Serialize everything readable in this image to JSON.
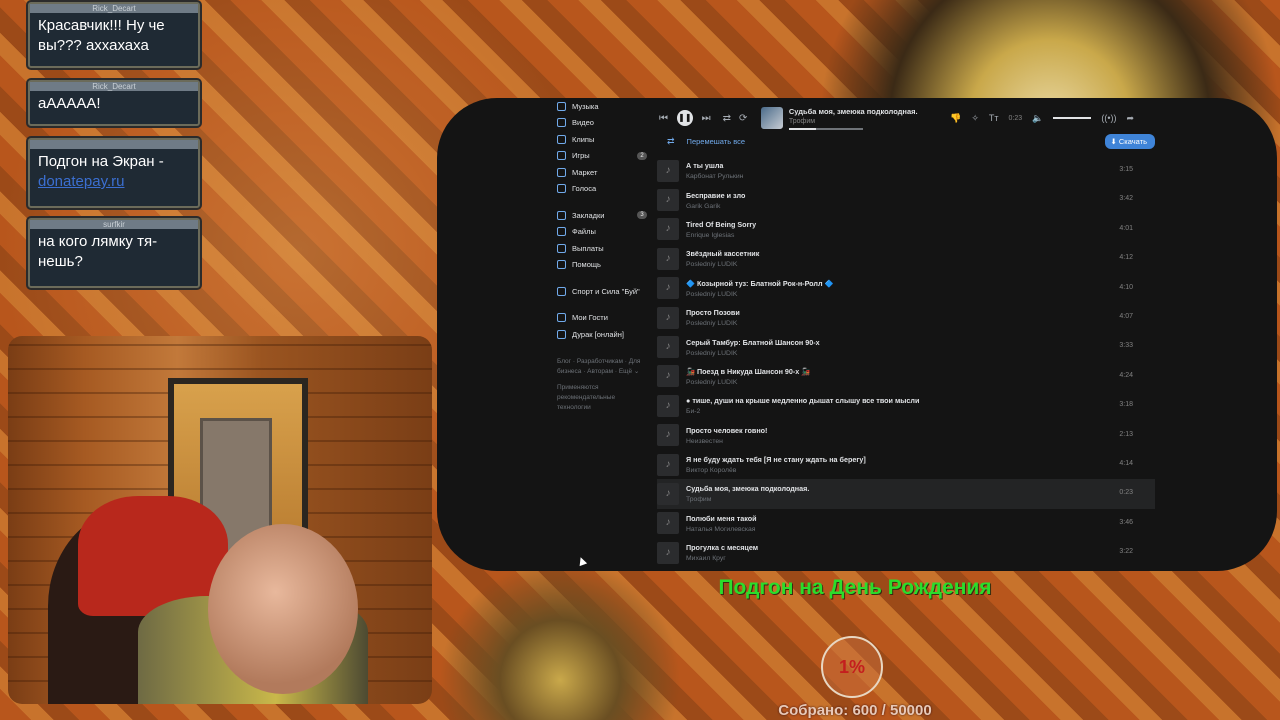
{
  "chat": [
    {
      "user": "Rick_Decart",
      "text": "Красавчик!!! Ну че вы??? аххахаха"
    },
    {
      "user": "Rick_Decart",
      "text": "аААААА!"
    },
    {
      "user": "",
      "text": "Подгон на Экран -",
      "link": "donatepay.ru"
    },
    {
      "user": "surfkir",
      "text": "на кого лямку тя-нешь?"
    }
  ],
  "sidebar": {
    "items": [
      {
        "label": "Музыка",
        "icon": "music-icon"
      },
      {
        "label": "Видео",
        "icon": "video-icon"
      },
      {
        "label": "Клипы",
        "icon": "clips-icon"
      },
      {
        "label": "Игры",
        "icon": "games-icon",
        "count": "2"
      },
      {
        "label": "Маркет",
        "icon": "market-icon"
      },
      {
        "label": "Голоса",
        "icon": "votes-icon"
      },
      {
        "label": "Закладки",
        "icon": "bookmark-icon",
        "count": "3"
      },
      {
        "label": "Файлы",
        "icon": "files-icon"
      },
      {
        "label": "Выплаты",
        "icon": "payouts-icon"
      },
      {
        "label": "Помощь",
        "icon": "help-icon"
      },
      {
        "label": "Спорт и Сила \"Буй\"",
        "icon": "group-icon"
      },
      {
        "label": "Мои Гости",
        "icon": "guests-icon"
      },
      {
        "label": "Дурак [онлайн]",
        "icon": "game-pad-icon"
      }
    ],
    "footer": "Блог · Разработчикам · Для бизнеса · Авторам · Ещё ⌄",
    "footer2": "Применяются рекомендательные технологии"
  },
  "player": {
    "title": "Судьба моя, змеюка подколодная.",
    "artist": "Трофим",
    "time": "0:23",
    "progress": 0.37
  },
  "shuffle_label": "Перемешать все",
  "download_label": "Скачать",
  "tracks": [
    {
      "title": "А ты ушла",
      "artist": "Карбонат Рулькин",
      "dur": "3:15"
    },
    {
      "title": "Бесправие и зло",
      "artist": "Garik Garik",
      "dur": "3:42"
    },
    {
      "title": "Tired Of Being Sorry",
      "artist": "Enrique Iglesias",
      "dur": "4:01"
    },
    {
      "title": "Звёздный кассетник",
      "artist": "Posledniy LUDIK",
      "dur": "4:12"
    },
    {
      "title": "🔷 Козырной туз: Блатной Рок-н-Ролл 🔷",
      "artist": "Posledniy LUDIK",
      "dur": "4:10"
    },
    {
      "title": "Просто Позови",
      "artist": "Posledniy LUDIK",
      "dur": "4:07"
    },
    {
      "title": "Серый Тамбур: Блатной Шансон 90-х",
      "artist": "Posledniy LUDIK",
      "dur": "3:33"
    },
    {
      "title": "🚂 Поезд в Никуда Шансон 90-х 🚂",
      "artist": "Posledniy LUDIK",
      "dur": "4:24"
    },
    {
      "title": "● тише, души на крыше медленно дышат слышу все твои мысли",
      "artist": "Би-2",
      "dur": "3:18"
    },
    {
      "title": "Просто человек говно!",
      "artist": "Неизвестен",
      "dur": "2:13"
    },
    {
      "title": "Я не буду ждать тебя [Я не стану ждать на берегу]",
      "artist": "Виктор Королёв",
      "dur": "4:14"
    },
    {
      "title": "Судьба моя, змеюка подколодная.",
      "artist": "Трофим",
      "dur": "0:23",
      "active": true
    },
    {
      "title": "Полюби меня такой",
      "artist": "Наталья Могилевская",
      "dur": "3:46"
    },
    {
      "title": "Прогулка с месяцем",
      "artist": "Михаил Круг",
      "dur": "3:22"
    }
  ],
  "goal": {
    "title": "Подгон на День Рождения",
    "percent": "1%",
    "collected": "Собрано: 600 / 50000"
  }
}
